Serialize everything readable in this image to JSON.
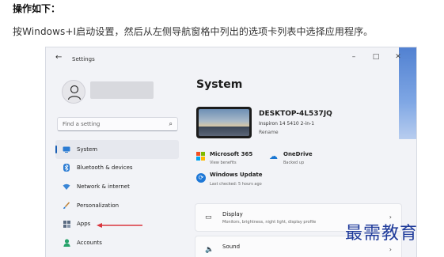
{
  "article": {
    "heading": "操作如下：",
    "instruction": "按Windows+I启动设置，然后从左侧导航窗格中列出的选项卡列表中选择应用程序。"
  },
  "window": {
    "title": "Settings",
    "back_icon": "back-arrow-icon",
    "controls": {
      "minimize": "–",
      "maximize": "□",
      "close": "✕"
    }
  },
  "sidebar": {
    "search_placeholder": "Find a setting",
    "items": [
      {
        "label": "System",
        "icon": "system-display-icon",
        "selected": true
      },
      {
        "label": "Bluetooth & devices",
        "icon": "bluetooth-icon",
        "selected": false
      },
      {
        "label": "Network & internet",
        "icon": "network-icon",
        "selected": false
      },
      {
        "label": "Personalization",
        "icon": "brush-icon",
        "selected": false
      },
      {
        "label": "Apps",
        "icon": "apps-icon",
        "selected": false
      },
      {
        "label": "Accounts",
        "icon": "accounts-icon",
        "selected": false
      }
    ]
  },
  "main": {
    "page_title": "System",
    "device": {
      "name": "DESKTOP-4L537JQ",
      "model": "Inspiron 14 5410 2-in-1",
      "rename": "Rename"
    },
    "quick": {
      "ms365": {
        "title": "Microsoft 365",
        "subtitle": "View benefits"
      },
      "onedrive": {
        "title": "OneDrive",
        "subtitle": "Backed up"
      },
      "update": {
        "title": "Windows Update",
        "subtitle": "Last checked: 5 hours ago"
      }
    },
    "cards": [
      {
        "title": "Display",
        "subtitle": "Monitors, brightness, night light, display profile",
        "icon": "display-icon"
      },
      {
        "title": "Sound",
        "subtitle": "",
        "icon": "speaker-icon"
      }
    ]
  },
  "colors": {
    "accent": "#1a5fb4",
    "arrow": "#d9363e",
    "watermark": "#1e3a9a"
  },
  "watermark": "最需教育"
}
